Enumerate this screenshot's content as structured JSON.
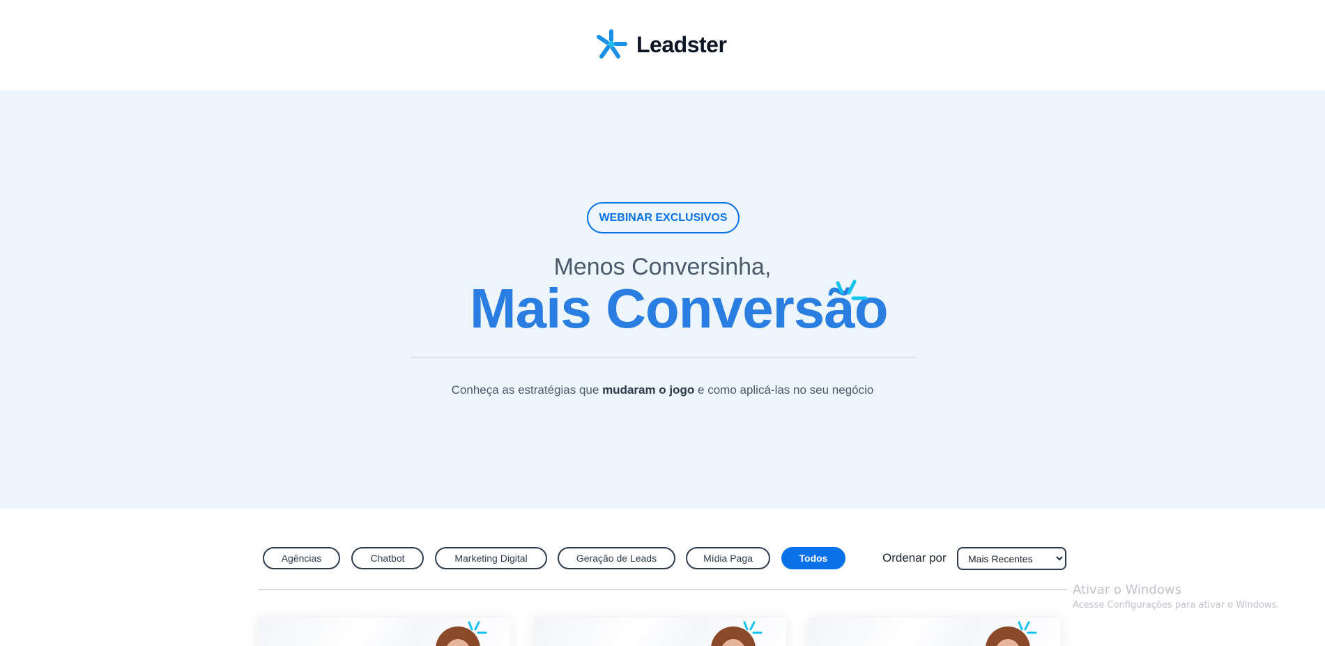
{
  "header": {
    "logo_text": "Leadster",
    "logo_color": "#1a8fe8"
  },
  "hero": {
    "badge": "WEBINAR EXCLUSIVOS",
    "subtitle": "Menos Conversinha,",
    "title": "Mais Conversão",
    "description_before": "Conheça as estratégias que ",
    "description_bold": "mudaram o jogo",
    "description_after": " e como aplicá-las no seu negócio",
    "background": "#eef6fd",
    "title_color": "#2a7de1"
  },
  "filters": {
    "items": [
      {
        "label": "Agências",
        "active": false
      },
      {
        "label": "Chatbot",
        "active": false
      },
      {
        "label": "Marketing Digital",
        "active": false
      },
      {
        "label": "Geração de Leads",
        "active": false
      },
      {
        "label": "Mídia Paga",
        "active": false
      },
      {
        "label": "Todos",
        "active": true
      }
    ],
    "sort_label": "Ordenar por",
    "sort_selected": "Mais Recentes",
    "accent": "#0a72e8"
  },
  "watermark": {
    "title": "Ativar o Windows",
    "subtitle": "Acesse Configurações para ativar o Windows."
  }
}
